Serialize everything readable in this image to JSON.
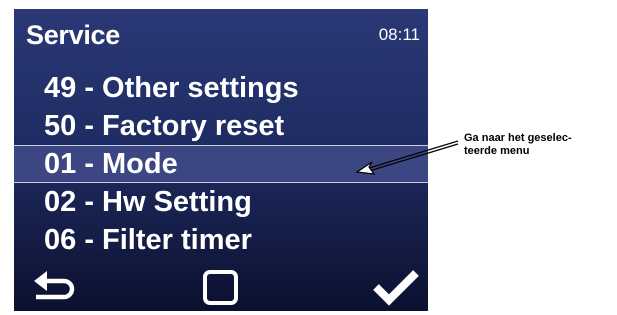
{
  "header": {
    "title": "Service",
    "clock": "08:11"
  },
  "menu": {
    "items": [
      {
        "label": "49 - Other settings"
      },
      {
        "label": "50 - Factory reset"
      },
      {
        "label": "01 - Mode"
      },
      {
        "label": "02 - Hw Setting"
      },
      {
        "label": "06 - Filter timer"
      }
    ],
    "selected_index": 2
  },
  "footer": {
    "back_icon": "back-arrow-icon",
    "ok_icon": "square-icon",
    "confirm_icon": "checkmark-icon"
  },
  "annotation": {
    "line1": "Ga naar het geselec-",
    "line2": "teerde menu"
  },
  "colors": {
    "screen_top": "#2a3876",
    "screen_bottom": "#0b1030",
    "selected_bg": "#3b4682",
    "text": "#ffffff"
  }
}
